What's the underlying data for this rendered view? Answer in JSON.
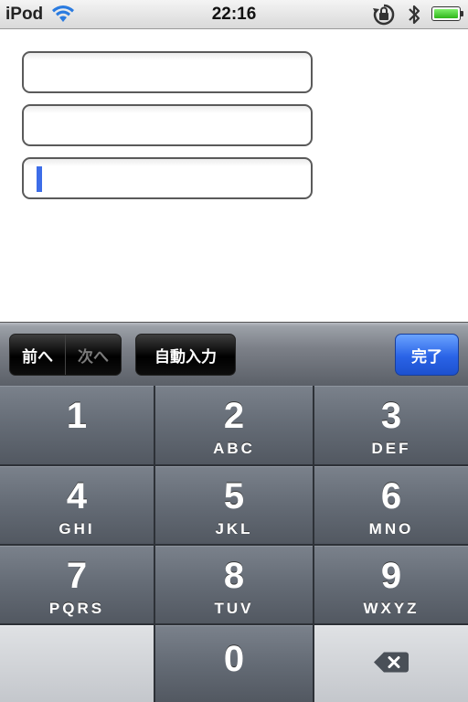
{
  "status_bar": {
    "carrier": "iPod",
    "time": "22:16",
    "icons": [
      "wifi-icon",
      "rotation-lock-icon",
      "bluetooth-icon",
      "battery-icon"
    ]
  },
  "form": {
    "fields": [
      {
        "value": ""
      },
      {
        "value": ""
      },
      {
        "value": "",
        "focused": true
      }
    ]
  },
  "toolbar": {
    "prev_label": "前へ",
    "next_label": "次へ",
    "autofill_label": "自動入力",
    "done_label": "完了"
  },
  "keypad": {
    "keys": [
      {
        "number": "1",
        "letters": ""
      },
      {
        "number": "2",
        "letters": "ABC"
      },
      {
        "number": "3",
        "letters": "DEF"
      },
      {
        "number": "4",
        "letters": "GHI"
      },
      {
        "number": "5",
        "letters": "JKL"
      },
      {
        "number": "6",
        "letters": "MNO"
      },
      {
        "number": "7",
        "letters": "PQRS"
      },
      {
        "number": "8",
        "letters": "TUV"
      },
      {
        "number": "9",
        "letters": "WXYZ"
      },
      {
        "number": "0",
        "letters": ""
      }
    ],
    "delete_icon": "backspace-icon"
  },
  "colors": {
    "accent": "#2a63e6",
    "cursor": "#3d6de8"
  }
}
